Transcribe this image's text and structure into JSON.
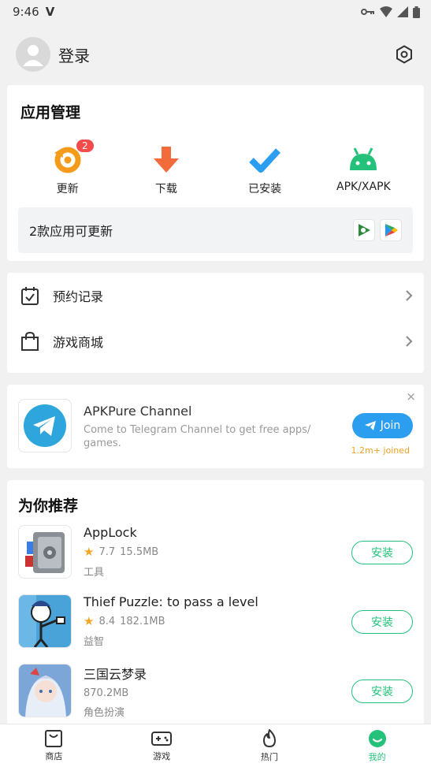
{
  "status_bar": {
    "time": "9:46",
    "carrier_glyph": "V"
  },
  "header": {
    "login_label": "登录",
    "avatar_icon": "person-icon",
    "settings_icon": "gear-icon"
  },
  "app_management": {
    "title": "应用管理",
    "items": [
      {
        "label": "更新",
        "icon": "refresh-icon",
        "badge": "2",
        "color": "#f59b1b"
      },
      {
        "label": "下载",
        "icon": "download-arrow-icon",
        "color": "#f26b3a"
      },
      {
        "label": "已安装",
        "icon": "checkmark-icon",
        "color": "#2b9ef0"
      },
      {
        "label": "APK/XAPK",
        "icon": "android-icon",
        "color": "#24c17a"
      }
    ],
    "update_bar": {
      "text": "2款应用可更新"
    }
  },
  "menu": [
    {
      "label": "预约记录",
      "icon": "calendar-check-icon"
    },
    {
      "label": "游戏商城",
      "icon": "shopping-bag-icon"
    }
  ],
  "promo": {
    "title": "APKPure Channel",
    "description": "Come to Telegram Channel to get free apps/ games.",
    "join_label": "Join",
    "joined_text": "1.2m+ joined",
    "close": "×"
  },
  "recommend": {
    "title": "为你推荐",
    "apps": [
      {
        "name": "AppLock",
        "rating": "7.7",
        "size": "15.5MB",
        "category": "工具",
        "install": "安装"
      },
      {
        "name": "Thief Puzzle: to pass a level",
        "rating": "8.4",
        "size": "182.1MB",
        "category": "益智",
        "install": "安装"
      },
      {
        "name": "三国云梦录",
        "size": "870.2MB",
        "category": "角色扮演",
        "install": "安装"
      }
    ]
  },
  "bottom_nav": [
    {
      "label": "商店",
      "icon": "store-icon"
    },
    {
      "label": "游戏",
      "icon": "gamepad-icon"
    },
    {
      "label": "热门",
      "icon": "flame-icon"
    },
    {
      "label": "我的",
      "icon": "smile-icon",
      "active": true
    }
  ],
  "colors": {
    "accent": "#24c17a",
    "telegram": "#2b9ef0",
    "badge": "#f44b4b"
  }
}
